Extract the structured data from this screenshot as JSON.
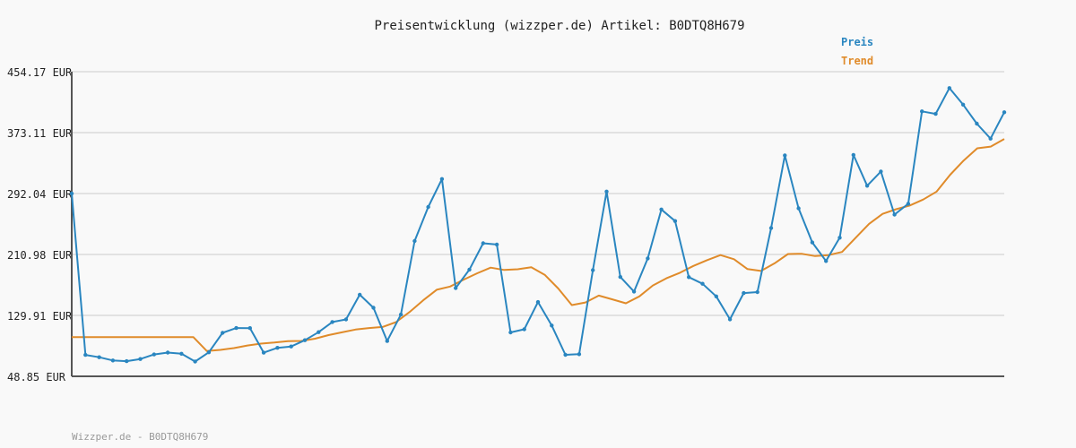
{
  "chart_data": {
    "type": "line",
    "title": "Preisentwicklung (wizzper.de) Artikel: B0DTQ8H679",
    "footer": "Wizzper.de - B0DTQ8H679",
    "unit": "EUR",
    "ylim": [
      48.85,
      454.17
    ],
    "yticks": [
      "454.17 EUR",
      "373.11 EUR",
      "292.04 EUR",
      "210.98 EUR",
      "129.91 EUR",
      "48.85 EUR"
    ],
    "grid": true,
    "legend_position": "top-right",
    "colors": {
      "preis": "#2a86c0",
      "trend": "#e08b2a",
      "grid": "#e2e2e2",
      "axis": "#555555"
    },
    "series": [
      {
        "name": "Preis",
        "values": [
          292.0,
          77.3,
          74.3,
          70.0,
          69.0,
          71.8,
          77.9,
          80.4,
          78.9,
          68.5,
          80.8,
          106.7,
          113.1,
          113.0,
          80.3,
          86.7,
          88.5,
          96.9,
          107.6,
          121.1,
          124.6,
          157.5,
          140.1,
          95.8,
          131.0,
          228.9,
          274.2,
          311.3,
          166.3,
          190.8,
          225.9,
          224.2,
          107.3,
          111.4,
          147.7,
          116.4,
          77.5,
          78.3,
          190.1,
          294.7,
          181.0,
          161.6,
          205.7,
          270.8,
          255.5,
          180.8,
          172.0,
          155.2,
          124.7,
          159.6,
          160.9,
          246.2,
          342.8,
          272.4,
          226.9,
          202.3,
          233.3,
          343.4,
          302.4,
          321.4,
          264.0,
          278.4,
          401.3,
          398.0,
          432.3,
          410.3,
          385.0,
          365.1,
          400.2
        ]
      },
      {
        "name": "Trend",
        "values": [
          101.0,
          101.0,
          101.0,
          101.0,
          101.0,
          101.0,
          101.0,
          101.0,
          101.0,
          101.0,
          82.5,
          84.0,
          86.4,
          89.9,
          92.4,
          93.8,
          95.7,
          95.9,
          98.9,
          103.7,
          107.4,
          111.1,
          113.1,
          114.5,
          121.0,
          134.5,
          150.0,
          164.0,
          168.3,
          177.5,
          186.0,
          193.4,
          190.3,
          191.3,
          193.9,
          183.9,
          165.7,
          143.6,
          147.1,
          156.3,
          151.2,
          146.0,
          155.2,
          169.7,
          179.3,
          186.7,
          195.7,
          203.3,
          210.1,
          204.7,
          191.6,
          189.1,
          199.2,
          211.6,
          211.9,
          208.8,
          210.2,
          214.3,
          233.1,
          251.8,
          265.0,
          271.2,
          276.1,
          284.1,
          294.7,
          317.1,
          336.0,
          352.2,
          354.5,
          364.7
        ]
      }
    ]
  }
}
